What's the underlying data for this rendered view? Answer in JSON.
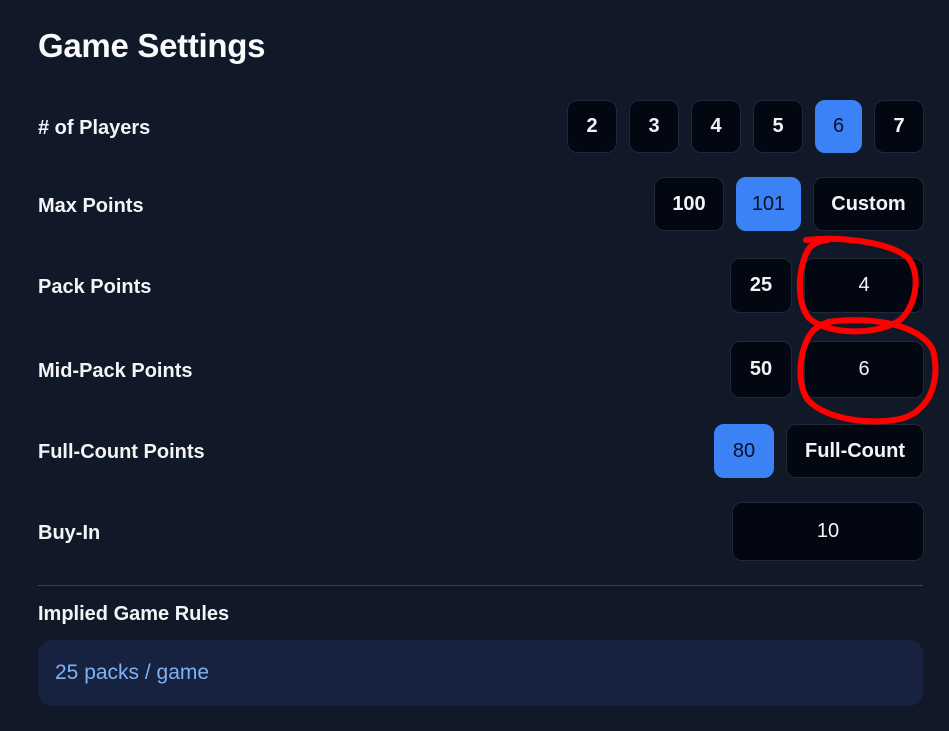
{
  "title": "Game Settings",
  "players": {
    "label": "# of Players",
    "options": [
      "2",
      "3",
      "4",
      "5",
      "6",
      "7"
    ],
    "selected": "6"
  },
  "max_points": {
    "label": "Max Points",
    "options": [
      "100",
      "101",
      "Custom"
    ],
    "selected": "101"
  },
  "pack_points": {
    "label": "Pack Points",
    "option": "25",
    "value": "4"
  },
  "mid_pack_points": {
    "label": "Mid-Pack Points",
    "option": "50",
    "value": "6"
  },
  "full_count_points": {
    "label": "Full-Count Points",
    "options": [
      "80",
      "Full-Count"
    ],
    "selected": "80"
  },
  "buy_in": {
    "label": "Buy-In",
    "value": "10"
  },
  "implied_rules": {
    "title": "Implied Game Rules",
    "text": "25 packs / game"
  },
  "colors": {
    "background": "#111827",
    "accent": "#3b82f6",
    "button_bg": "#030712",
    "annotation": "#ff0000"
  }
}
